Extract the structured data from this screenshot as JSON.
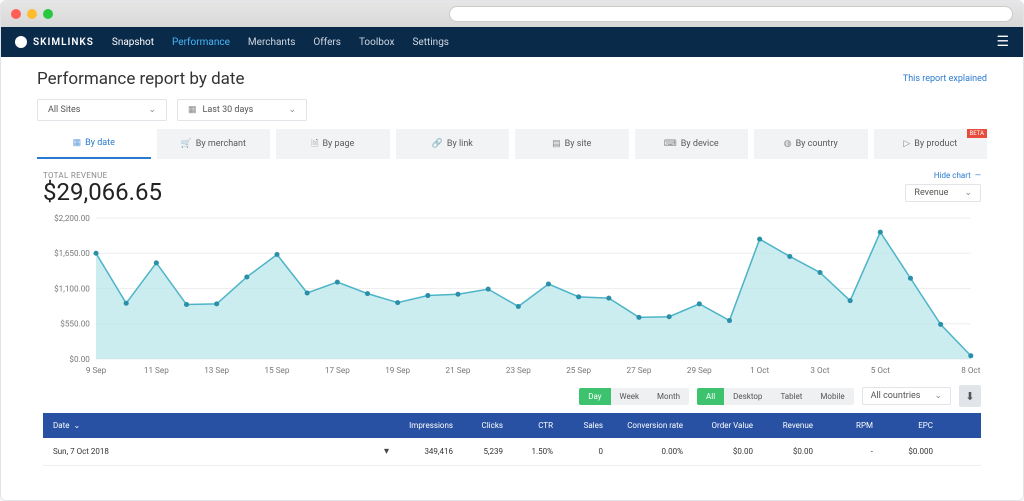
{
  "brand": "SKIMLINKS",
  "nav": {
    "items": [
      {
        "label": "Snapshot",
        "active": false
      },
      {
        "label": "Performance",
        "active": true
      },
      {
        "label": "Merchants",
        "active": false
      },
      {
        "label": "Offers",
        "active": false
      },
      {
        "label": "Toolbox",
        "active": false
      },
      {
        "label": "Settings",
        "active": false
      }
    ]
  },
  "page": {
    "title": "Performance report by date",
    "explain_link": "This report explained"
  },
  "filters": {
    "site_selector": "All Sites",
    "date_range": "Last 30 days"
  },
  "tabs": [
    {
      "label": "By date",
      "icon": "calendar-icon",
      "active": true
    },
    {
      "label": "By merchant",
      "icon": "cart-icon"
    },
    {
      "label": "By page",
      "icon": "page-icon"
    },
    {
      "label": "By link",
      "icon": "link-icon"
    },
    {
      "label": "By site",
      "icon": "site-icon"
    },
    {
      "label": "By device",
      "icon": "device-icon"
    },
    {
      "label": "By country",
      "icon": "globe-icon"
    },
    {
      "label": "By product",
      "icon": "tag-icon",
      "beta": "BETA"
    }
  ],
  "chart": {
    "total_label": "TOTAL REVENUE",
    "total_value": "$29,066.65",
    "hide_label": "Hide chart",
    "metric": "Revenue"
  },
  "chart_data": {
    "type": "area",
    "ylabel": "Revenue ($)",
    "ylim": [
      0,
      2200
    ],
    "y_ticks": [
      "$0.00",
      "$550.00",
      "$1,100.00",
      "$1,650.00",
      "$2,200.00"
    ],
    "x_ticks": [
      "9 Sep",
      "11 Sep",
      "13 Sep",
      "15 Sep",
      "17 Sep",
      "19 Sep",
      "21 Sep",
      "23 Sep",
      "25 Sep",
      "27 Sep",
      "29 Sep",
      "1 Oct",
      "3 Oct",
      "5 Oct",
      "8 Oct"
    ],
    "categories": [
      "9 Sep",
      "10 Sep",
      "11 Sep",
      "12 Sep",
      "13 Sep",
      "14 Sep",
      "15 Sep",
      "16 Sep",
      "17 Sep",
      "18 Sep",
      "19 Sep",
      "20 Sep",
      "21 Sep",
      "22 Sep",
      "23 Sep",
      "24 Sep",
      "25 Sep",
      "26 Sep",
      "27 Sep",
      "28 Sep",
      "29 Sep",
      "30 Sep",
      "1 Oct",
      "2 Oct",
      "3 Oct",
      "4 Oct",
      "5 Oct",
      "6 Oct",
      "7 Oct",
      "8 Oct"
    ],
    "values": [
      1650,
      870,
      1500,
      850,
      860,
      1280,
      1630,
      1030,
      1200,
      1020,
      880,
      990,
      1010,
      1090,
      820,
      1170,
      970,
      950,
      650,
      660,
      860,
      600,
      1870,
      1600,
      1350,
      910,
      1980,
      1260,
      540,
      50
    ]
  },
  "granularity": {
    "options": [
      "Day",
      "Week",
      "Month"
    ],
    "active": "Day"
  },
  "device_filter": {
    "options": [
      "All",
      "Desktop",
      "Tablet",
      "Mobile"
    ],
    "active": "All"
  },
  "country_filter": "All countries",
  "table": {
    "headers": {
      "date": "Date",
      "impressions": "Impressions",
      "clicks": "Clicks",
      "ctr": "CTR",
      "sales": "Sales",
      "conv": "Conversion rate",
      "ov": "Order Value",
      "rev": "Revenue",
      "rpm": "RPM",
      "epc": "EPC"
    },
    "rows": [
      {
        "date": "Sun, 7 Oct 2018",
        "impressions": "349,416",
        "clicks": "5,239",
        "ctr": "1.50%",
        "sales": "0",
        "conv": "0.00%",
        "ov": "$0.00",
        "rev": "$0.00",
        "rpm": "-",
        "epc": "$0.000"
      }
    ]
  }
}
